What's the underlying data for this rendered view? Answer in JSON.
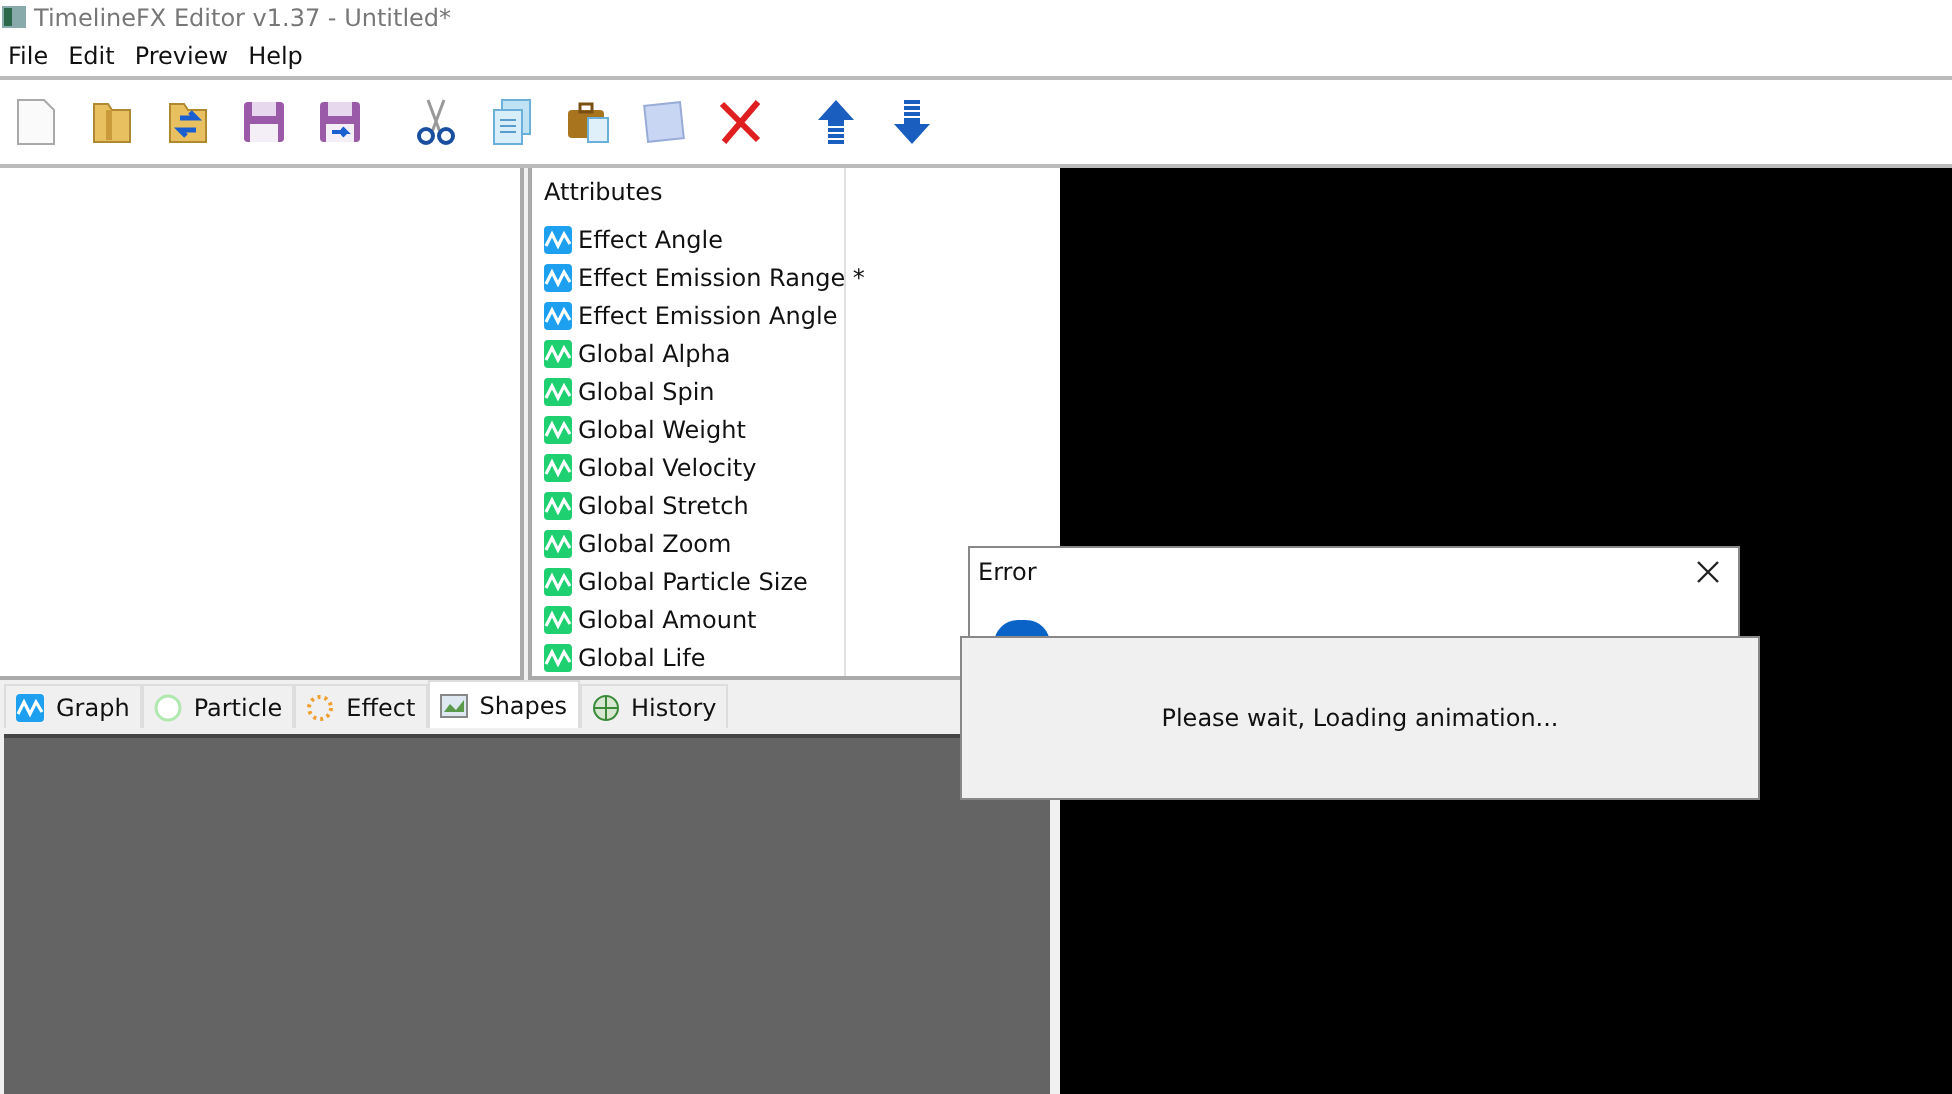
{
  "window": {
    "title": "TimelineFX Editor v1.37 - Untitled*"
  },
  "menu": [
    "File",
    "Edit",
    "Preview",
    "Help"
  ],
  "toolbar": [
    {
      "kind": "new"
    },
    {
      "kind": "open"
    },
    {
      "kind": "import"
    },
    {
      "kind": "save"
    },
    {
      "kind": "saveas"
    },
    {
      "kind": "cut"
    },
    {
      "kind": "copy"
    },
    {
      "kind": "paste"
    },
    {
      "kind": "clone"
    },
    {
      "kind": "delete"
    },
    {
      "kind": "up"
    },
    {
      "kind": "down"
    }
  ],
  "attributes": {
    "header": "Attributes",
    "items": [
      {
        "label": "Effect Angle",
        "color": "#1ea0f0"
      },
      {
        "label": "Effect Emission Range *",
        "color": "#1ea0f0"
      },
      {
        "label": "Effect Emission Angle",
        "color": "#1ea0f0"
      },
      {
        "label": "Global Alpha",
        "color": "#1ed070"
      },
      {
        "label": "Global Spin",
        "color": "#1ed070"
      },
      {
        "label": "Global Weight",
        "color": "#1ed070"
      },
      {
        "label": "Global Velocity",
        "color": "#1ed070"
      },
      {
        "label": "Global Stretch",
        "color": "#1ed070"
      },
      {
        "label": "Global Zoom",
        "color": "#1ed070"
      },
      {
        "label": "Global Particle Size",
        "color": "#1ed070"
      },
      {
        "label": "Global Amount",
        "color": "#1ed070"
      },
      {
        "label": "Global Life",
        "color": "#1ed070"
      }
    ]
  },
  "tabs": [
    {
      "label": "Graph",
      "kind": "graph",
      "selected": false
    },
    {
      "label": "Particle",
      "kind": "particle",
      "selected": false
    },
    {
      "label": "Effect",
      "kind": "effect",
      "selected": false
    },
    {
      "label": "Shapes",
      "kind": "shapes",
      "selected": true
    },
    {
      "label": "History",
      "kind": "history",
      "selected": false
    }
  ],
  "error_dialog": {
    "title": "Error"
  },
  "loading_dialog": {
    "message": "Please wait, Loading animation..."
  }
}
